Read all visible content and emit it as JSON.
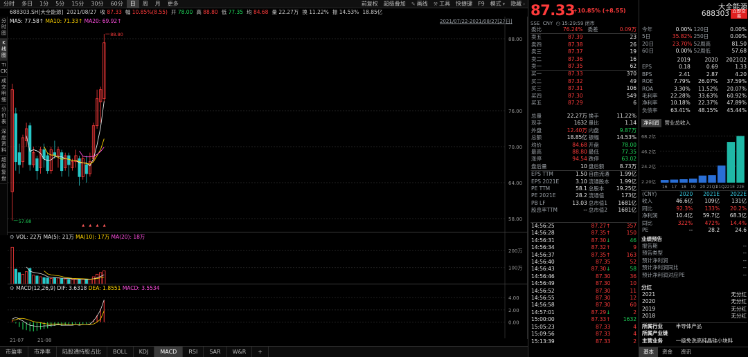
{
  "top_tabs": [
    "分时",
    "多日",
    "1分",
    "5分",
    "15分",
    "30分",
    "60分",
    "日",
    "周",
    "月",
    "更多"
  ],
  "toolbar": {
    "tools": [
      "前复权",
      "超级叠加",
      "画线",
      "工具",
      "快捷键",
      "F9",
      "模式",
      "隐藏"
    ]
  },
  "info": {
    "code_name": "688303.SH[大全能源]",
    "date": "2021/08/27",
    "close_label": "收",
    "close": "87.33",
    "amp_label": "幅",
    "amp": "10.85%(8.55)",
    "open_label": "开",
    "open": "78.00",
    "high_label": "高",
    "high": "88.80",
    "low_label": "低",
    "low": "77.35",
    "avg_label": "均",
    "avg": "84.68",
    "vol_label": "量",
    "vol": "22.27万",
    "turn_label": "换",
    "turn": "11.22%",
    "zhen_label": "振",
    "zhen": "14.53%",
    "money": "18.85亿"
  },
  "left_tabs": [
    "分时图",
    "K线图",
    "TICK",
    "成交明细",
    "分价表",
    "深度资料",
    "超级复盘"
  ],
  "ma_legend": {
    "ma5": "MA5: 77.58↑",
    "ma10": "MA10: 71.33↑",
    "ma20": "MA20: 69.92↑"
  },
  "date_range": "2021/07/22-2021/08/27[27日]",
  "price_axis": [
    "88.00",
    "76.00",
    "70.00",
    "64.00",
    "58.00"
  ],
  "annotations": {
    "high": "88.80",
    "low": "57.68"
  },
  "vol_legend": {
    "vol": "VOL: 22万",
    "ma5": "MA(5): 21万",
    "ma10": "MA(10): 17万",
    "ma20": "MA(20): 18万"
  },
  "vol_axis": [
    "200万",
    "100万"
  ],
  "macd_legend": {
    "name": "MACD(12,26,9)",
    "dif": "DIF: 3.6318",
    "dea": "DEA: 1.8551",
    "macd": "MACD: 3.5534"
  },
  "macd_axis": [
    "4.00",
    "2.00",
    "0.00"
  ],
  "x_axis": [
    "21-07",
    "21-08"
  ],
  "bottom_tabs": [
    "市盈率",
    "市净率",
    "陆股通持股占比",
    "BOLL",
    "KDJ",
    "MACD",
    "RSI",
    "SAR",
    "W&R",
    "+"
  ],
  "chart_data": {
    "type": "candlestick",
    "ylim": [
      56.5,
      91
    ],
    "candles": [
      {
        "o": 62.5,
        "c": 79.5,
        "h": 80.5,
        "l": 57.68
      },
      {
        "o": 75.5,
        "c": 67.5,
        "h": 76.5,
        "l": 66.0
      },
      {
        "o": 69.0,
        "c": 67.0,
        "h": 70.5,
        "l": 65.5
      },
      {
        "o": 67.5,
        "c": 71.5,
        "h": 72.0,
        "l": 66.5
      },
      {
        "o": 71.0,
        "c": 73.0,
        "h": 74.0,
        "l": 70.0
      },
      {
        "o": 73.5,
        "c": 67.0,
        "h": 74.0,
        "l": 66.0
      },
      {
        "o": 67.0,
        "c": 69.0,
        "h": 70.0,
        "l": 66.5
      },
      {
        "o": 68.0,
        "c": 66.0,
        "h": 68.5,
        "l": 64.5
      },
      {
        "o": 66.5,
        "c": 69.5,
        "h": 70.0,
        "l": 65.5
      },
      {
        "o": 69.5,
        "c": 68.0,
        "h": 70.5,
        "l": 66.5
      },
      {
        "o": 68.5,
        "c": 66.0,
        "h": 69.0,
        "l": 65.5
      },
      {
        "o": 66.0,
        "c": 69.5,
        "h": 70.0,
        "l": 65.5
      },
      {
        "o": 69.0,
        "c": 68.5,
        "h": 71.0,
        "l": 68.0
      },
      {
        "o": 68.5,
        "c": 69.5,
        "h": 70.0,
        "l": 66.5
      },
      {
        "o": 69.0,
        "c": 66.0,
        "h": 69.5,
        "l": 65.0
      },
      {
        "o": 66.5,
        "c": 68.5,
        "h": 69.0,
        "l": 66.0
      },
      {
        "o": 68.5,
        "c": 67.0,
        "h": 69.0,
        "l": 65.0
      },
      {
        "o": 66.5,
        "c": 67.5,
        "h": 68.0,
        "l": 66.0
      },
      {
        "o": 67.5,
        "c": 68.5,
        "h": 69.5,
        "l": 66.5
      },
      {
        "o": 68.0,
        "c": 65.0,
        "h": 68.5,
        "l": 63.5
      },
      {
        "o": 65.0,
        "c": 68.0,
        "h": 68.5,
        "l": 64.5
      },
      {
        "o": 67.0,
        "c": 65.5,
        "h": 68.5,
        "l": 64.0
      },
      {
        "o": 65.5,
        "c": 67.5,
        "h": 69.0,
        "l": 65.0
      },
      {
        "o": 68.0,
        "c": 73.5,
        "h": 74.0,
        "l": 67.5
      },
      {
        "o": 73.5,
        "c": 78.0,
        "h": 79.5,
        "l": 73.0
      },
      {
        "o": 77.5,
        "c": 79.5,
        "h": 80.0,
        "l": 74.0
      },
      {
        "o": 78.0,
        "c": 87.33,
        "h": 88.8,
        "l": 77.35
      }
    ],
    "ma5": [
      null,
      null,
      null,
      null,
      71.8,
      69.2,
      69.5,
      69.3,
      68.9,
      67.9,
      67.7,
      67.8,
      68.3,
      68.3,
      68.3,
      68.0,
      67.9,
      67.7,
      67.7,
      67.3,
      67.3,
      67.3,
      66.8,
      68.0,
      70.3,
      73.2,
      77.58
    ],
    "ma10": [
      null,
      null,
      null,
      null,
      null,
      null,
      null,
      null,
      null,
      70.0,
      68.9,
      68.6,
      68.6,
      68.2,
      67.9,
      68.0,
      67.9,
      67.7,
      67.7,
      67.5,
      67.3,
      67.2,
      67.1,
      67.5,
      68.5,
      69.5,
      71.33
    ],
    "ma20": [
      null,
      null,
      null,
      null,
      null,
      null,
      null,
      null,
      null,
      null,
      null,
      null,
      null,
      null,
      null,
      null,
      null,
      null,
      null,
      69.3,
      68.4,
      68.3,
      68.3,
      68.4,
      68.7,
      69.2,
      69.92
    ],
    "volume": [
      220,
      90,
      70,
      60,
      75,
      95,
      55,
      50,
      45,
      40,
      38,
      35,
      40,
      38,
      34,
      32,
      30,
      28,
      30,
      33,
      30,
      28,
      30,
      45,
      60,
      70,
      80
    ],
    "macd_hist": [
      0.3,
      -0.2,
      -0.8,
      -1.2,
      -1.3,
      -1.5,
      -1.5,
      -1.4,
      -1.2,
      -1.1,
      -1.0,
      -0.8,
      -0.6,
      -0.5,
      -0.6,
      -0.5,
      -0.4,
      -0.4,
      -0.3,
      -0.4,
      -0.3,
      -0.3,
      -0.1,
      0.4,
      1.2,
      2.2,
      3.55
    ],
    "dif": [
      0.5,
      0.8,
      0.5,
      0.2,
      -0.2,
      -0.5,
      -0.6,
      -0.7,
      -0.7,
      -0.6,
      -0.6,
      -0.5,
      -0.5,
      -0.4,
      -0.5,
      -0.5,
      -0.5,
      -0.5,
      -0.4,
      -0.5,
      -0.4,
      -0.4,
      -0.3,
      0.2,
      1.0,
      2.0,
      3.6318
    ],
    "dea": [
      0.3,
      0.4,
      0.6,
      0.6,
      0.5,
      0.3,
      0.1,
      0.0,
      -0.1,
      -0.2,
      -0.3,
      -0.3,
      -0.3,
      -0.3,
      -0.3,
      -0.3,
      -0.4,
      -0.4,
      -0.4,
      -0.4,
      -0.4,
      -0.4,
      -0.4,
      -0.3,
      0.0,
      0.5,
      1.8551
    ]
  },
  "quote": {
    "price": "87.33",
    "change": "+10.85% (+8.55)",
    "name": "大全能源",
    "code": "688303",
    "trade_btn": "立即交易",
    "market": "SSE",
    "currency": "CNY",
    "time": "15:29:59",
    "status": "闭市"
  },
  "order_book": {
    "weibi_label": "委比",
    "weibi": "76.24%",
    "weicha_label": "委差",
    "weicha": "0.09万",
    "sell": [
      {
        "label": "卖五",
        "price": "87.39",
        "vol": "23"
      },
      {
        "label": "卖四",
        "price": "87.38",
        "vol": "26"
      },
      {
        "label": "卖三",
        "price": "87.37",
        "vol": "19"
      },
      {
        "label": "卖二",
        "price": "87.36",
        "vol": "16"
      },
      {
        "label": "卖一",
        "price": "87.35",
        "vol": "62"
      }
    ],
    "buy": [
      {
        "label": "买一",
        "price": "87.33",
        "vol": "370"
      },
      {
        "label": "买二",
        "price": "87.32",
        "vol": "49"
      },
      {
        "label": "买三",
        "price": "87.31",
        "vol": "106"
      },
      {
        "label": "买四",
        "price": "87.30",
        "vol": "549"
      },
      {
        "label": "买五",
        "price": "87.29",
        "vol": "6"
      }
    ]
  },
  "stats": [
    {
      "l1": "总量",
      "v1": "22.27万",
      "l2": "换手",
      "v2": "11.22%",
      "c1": "w",
      "c2": "w"
    },
    {
      "l1": "现手",
      "v1": "1632",
      "l2": "量比",
      "v2": "1.14",
      "c1": "w",
      "c2": "w"
    },
    {
      "l1": "外盘",
      "v1": "12.40万",
      "l2": "内盘",
      "v2": "9.87万",
      "c1": "r",
      "c2": "g"
    },
    {
      "l1": "总额",
      "v1": "18.85亿",
      "l2": "振幅",
      "v2": "14.53%",
      "c1": "w",
      "c2": "w"
    },
    {
      "l1": "均价",
      "v1": "84.68",
      "l2": "开盘",
      "v2": "78.00",
      "c1": "r",
      "c2": "g"
    },
    {
      "l1": "最高",
      "v1": "88.80",
      "l2": "最低",
      "v2": "77.35",
      "c1": "r",
      "c2": "g"
    },
    {
      "l1": "涨停",
      "v1": "94.54",
      "l2": "跌停",
      "v2": "63.02",
      "c1": "r",
      "c2": "g"
    },
    {
      "l1": "盘后量",
      "v1": "10",
      "l2": "盘后额",
      "v2": "8.73万",
      "c1": "w",
      "c2": "w"
    },
    {
      "l1": "EPS TTM",
      "v1": "1.50",
      "l2": "自由流通",
      "v2": "1.99亿",
      "c1": "w",
      "c2": "w"
    },
    {
      "l1": "EPS 2021E",
      "v1": "3.10",
      "l2": "流通股本",
      "v2": "1.99亿",
      "c1": "w",
      "c2": "w"
    },
    {
      "l1": "PE TTM",
      "v1": "58.1",
      "l2": "总股本",
      "v2": "19.25亿",
      "c1": "w",
      "c2": "w"
    },
    {
      "l1": "PE 2021E",
      "v1": "28.2",
      "l2": "流通值",
      "v2": "173亿",
      "c1": "w",
      "c2": "w"
    },
    {
      "l1": "PB LF",
      "v1": "13.03",
      "l2": "总市值1",
      "v2": "1681亿",
      "c1": "w",
      "c2": "w"
    },
    {
      "l1": "股息率TTM",
      "v1": "--",
      "l2": "总市值2",
      "v2": "1681亿",
      "c1": "w",
      "c2": "w"
    }
  ],
  "ticks": [
    {
      "t": "14:56:25",
      "p": "87.27",
      "a": "↑",
      "v": "357",
      "vc": "r"
    },
    {
      "t": "14:56:28",
      "p": "87.35",
      "a": "↑",
      "v": "150",
      "vc": "r"
    },
    {
      "t": "14:56:31",
      "p": "87.30",
      "a": "↓",
      "v": "46",
      "vc": "g"
    },
    {
      "t": "14:56:34",
      "p": "87.32",
      "a": "↑",
      "v": "9",
      "vc": "r"
    },
    {
      "t": "14:56:37",
      "p": "87.35",
      "a": "↑",
      "v": "163",
      "vc": "r"
    },
    {
      "t": "14:56:40",
      "p": "87.35",
      "a": "",
      "v": "52",
      "vc": "r"
    },
    {
      "t": "14:56:43",
      "p": "87.30",
      "a": "↓",
      "v": "58",
      "vc": "g"
    },
    {
      "t": "14:56:46",
      "p": "87.30",
      "a": "",
      "v": "36",
      "vc": "r"
    },
    {
      "t": "14:56:49",
      "p": "87.30",
      "a": "",
      "v": "10",
      "vc": "r"
    },
    {
      "t": "14:56:52",
      "p": "87.30",
      "a": "",
      "v": "11",
      "vc": "r"
    },
    {
      "t": "14:56:55",
      "p": "87.30",
      "a": "",
      "v": "12",
      "vc": "r"
    },
    {
      "t": "14:56:58",
      "p": "87.30",
      "a": "",
      "v": "60",
      "vc": "r"
    },
    {
      "t": "14:57:01",
      "p": "87.29",
      "a": "↓",
      "v": "2",
      "vc": "r"
    },
    {
      "t": "15:00:00",
      "p": "87.33",
      "a": "↑",
      "v": "1632",
      "vc": "g"
    },
    {
      "t": "15:05:23",
      "p": "87.33",
      "a": "",
      "v": "4",
      "vc": "r"
    },
    {
      "t": "15:09:56",
      "p": "87.33",
      "a": "",
      "v": "4",
      "vc": "r"
    },
    {
      "t": "15:13:39",
      "p": "87.33",
      "a": "",
      "v": "2",
      "vc": "r"
    }
  ],
  "perf": {
    "rows": [
      {
        "l1": "今年",
        "v1": "0.00%",
        "l2": "120日",
        "v2": "0.00%"
      },
      {
        "l1": "5日",
        "v1": "35.82%",
        "l2": "250日",
        "v2": "0.00%"
      },
      {
        "l1": "20日",
        "v1": "23.70%",
        "l2": "52周高",
        "v2": "81.50"
      },
      {
        "l1": "60日",
        "v1": "0.00%",
        "l2": "52周低",
        "v2": "57.68"
      }
    ],
    "years": [
      "2019",
      "2020",
      "2021Q2"
    ],
    "metrics": [
      {
        "l": "EPS",
        "v": [
          "0.18",
          "0.69",
          "1.33"
        ]
      },
      {
        "l": "BPS",
        "v": [
          "2.41",
          "2.87",
          "4.20"
        ]
      },
      {
        "l": "ROE",
        "v": [
          "7.79%",
          "26.07%",
          "37.59%"
        ]
      },
      {
        "l": "ROA",
        "v": [
          "3.30%",
          "11.52%",
          "20.07%"
        ]
      },
      {
        "l": "毛利率",
        "v": [
          "22.28%",
          "33.63%",
          "60.92%"
        ]
      },
      {
        "l": "净利率",
        "v": [
          "10.18%",
          "22.37%",
          "47.89%"
        ]
      },
      {
        "l": "负债率",
        "v": [
          "63.41%",
          "48.15%",
          "45.44%"
        ]
      }
    ]
  },
  "rev_chart": {
    "tabs": [
      "净利润",
      "营业总收入"
    ],
    "yaxis": [
      "68.2亿",
      "46.2亿",
      "24.2亿",
      "2.20亿"
    ],
    "xaxis": [
      "16",
      "17",
      "18",
      "19",
      "20",
      "21Q1",
      "21Q2",
      "21E",
      "22E"
    ],
    "values": [
      4.0,
      4.5,
      5.0,
      5.8,
      10.4,
      11.0,
      25.0,
      59.7,
      68.3
    ]
  },
  "forecast": {
    "header": {
      "l": "(CNY)",
      "y": [
        "2020",
        "2021E",
        "2022E"
      ]
    },
    "rows": [
      {
        "l": "收入",
        "v": [
          "46.6亿",
          "109亿",
          "131亿"
        ],
        "c": [
          "w",
          "w",
          "w"
        ]
      },
      {
        "l": "同比",
        "v": [
          "92.3%",
          "133%",
          "20.2%"
        ],
        "c": [
          "r",
          "r",
          "r"
        ]
      },
      {
        "l": "净利润",
        "v": [
          "10.4亿",
          "59.7亿",
          "68.3亿"
        ],
        "c": [
          "w",
          "w",
          "w"
        ]
      },
      {
        "l": "同比",
        "v": [
          "322%",
          "472%",
          "14.4%"
        ],
        "c": [
          "r",
          "r",
          "r"
        ]
      },
      {
        "l": "PE",
        "v": [
          "--",
          "28.2",
          "24.6"
        ],
        "c": [
          "w",
          "w",
          "w"
        ]
      }
    ]
  },
  "perf_forecast": {
    "title": "业绩预告",
    "rows": [
      {
        "l": "报告期",
        "v": "--"
      },
      {
        "l": "预告类型",
        "v": "--"
      },
      {
        "l": "预计净利润",
        "v": "--"
      },
      {
        "l": "预计净利润同比",
        "v": "--"
      },
      {
        "l": "预计净利润对应PE",
        "v": "--"
      }
    ]
  },
  "dividend": {
    "title": "分红",
    "rows": [
      {
        "y": "2021",
        "v": "无分红"
      },
      {
        "y": "2020",
        "v": "无分红"
      },
      {
        "y": "2019",
        "v": "无分红"
      },
      {
        "y": "2018",
        "v": "无分红"
      }
    ]
  },
  "industry": [
    {
      "l": "所属行业",
      "v": "半导体产品"
    },
    {
      "l": "所属产业链",
      "v": ""
    },
    {
      "l": "主营业务",
      "v": "一级免洗高纯晶硅",
      "extra": "小块料"
    }
  ],
  "right_bottom_tabs": [
    "基本",
    "资金",
    "资讯"
  ]
}
